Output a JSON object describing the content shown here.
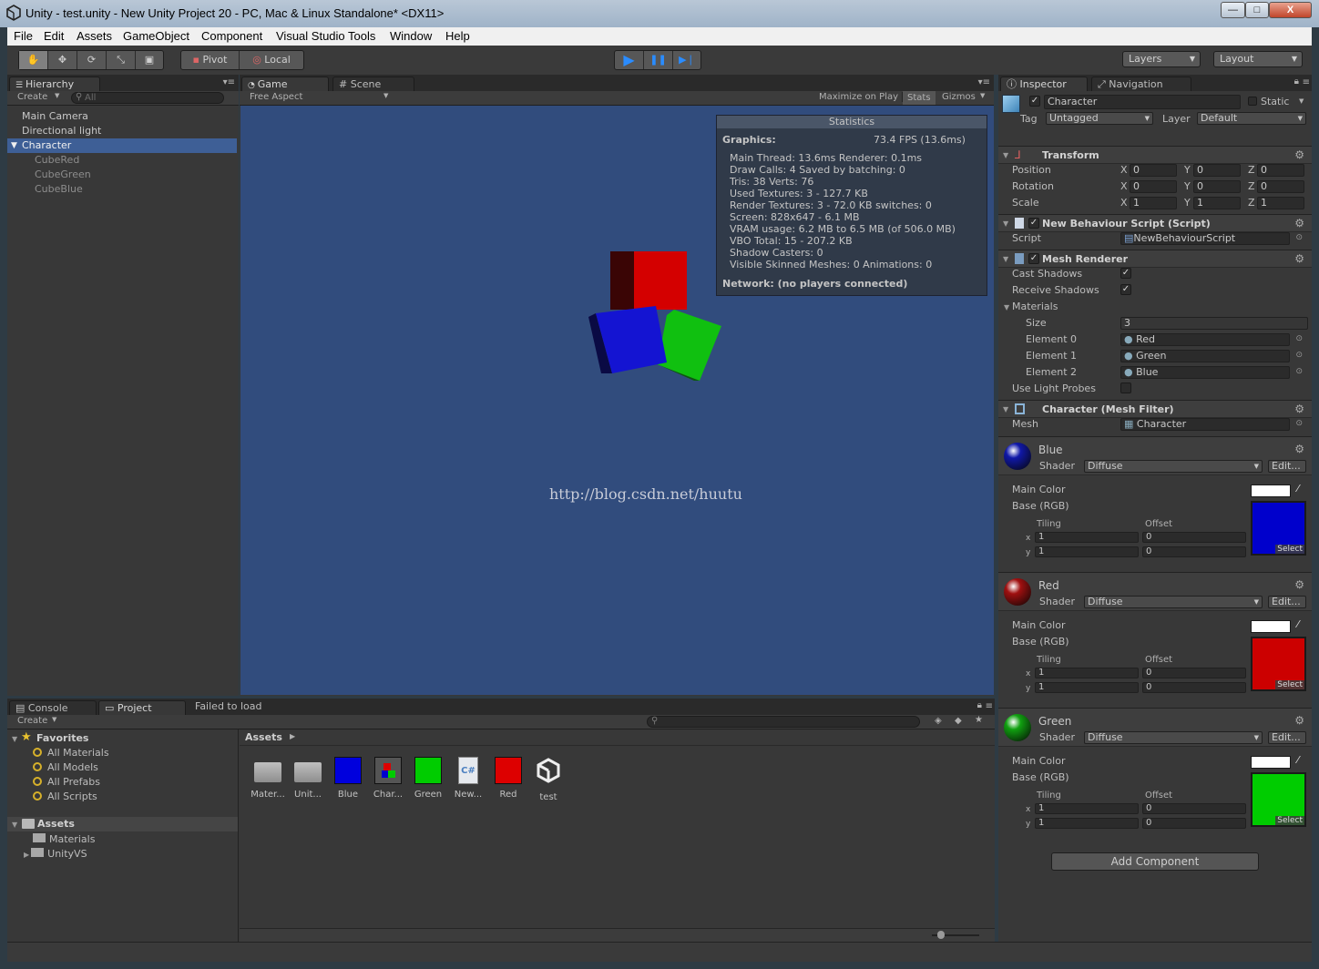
{
  "window": {
    "title": "Unity - test.unity - New Unity Project 20 - PC, Mac & Linux Standalone* <DX11>",
    "min_label": "—",
    "max_label": "□",
    "close_label": "X"
  },
  "menu": [
    "File",
    "Edit",
    "Assets",
    "GameObject",
    "Component",
    "Visual Studio Tools",
    "Window",
    "Help"
  ],
  "toolbar": {
    "pivot": "Pivot",
    "local": "Local",
    "layers": "Layers",
    "layout": "Layout"
  },
  "hierarchy": {
    "tab": "Hierarchy",
    "create": "Create",
    "search_placeholder": "All",
    "items": [
      "Main Camera",
      "Directional light",
      "Character",
      "CubeRed",
      "CubeGreen",
      "CubeBlue"
    ]
  },
  "game": {
    "tab_game": "Game",
    "tab_scene": "Scene",
    "aspect": "Free Aspect",
    "maximize": "Maximize on Play",
    "stats": "Stats",
    "gizmos": "Gizmos",
    "watermark": "http://blog.csdn.net/huutu"
  },
  "stats": {
    "title": "Statistics",
    "graphics_label": "Graphics:",
    "fps": "73.4 FPS (13.6ms)",
    "lines": [
      "Main Thread: 13.6ms  Renderer: 0.1ms",
      "Draw Calls: 4          Saved by batching: 0",
      "Tris: 38   Verts: 76",
      "Used Textures: 3 - 127.7 KB",
      "Render Textures: 3 - 72.0 KB    switches: 0",
      "Screen: 828x647 - 6.1 MB",
      "VRAM usage: 6.2 MB to 6.5 MB (of 506.0 MB)",
      "VBO Total: 15 - 207.2 KB",
      "Shadow Casters: 0",
      "Visible Skinned Meshes: 0         Animations: 0"
    ],
    "network": "Network: (no players connected)"
  },
  "inspector": {
    "tab_inspector": "Inspector",
    "tab_navigation": "Navigation",
    "object_name": "Character",
    "static": "Static",
    "tag_label": "Tag",
    "tag_value": "Untagged",
    "layer_label": "Layer",
    "layer_value": "Default",
    "transform": {
      "title": "Transform",
      "rows": [
        {
          "label": "Position",
          "x": "0",
          "y": "0",
          "z": "0"
        },
        {
          "label": "Rotation",
          "x": "0",
          "y": "0",
          "z": "0"
        },
        {
          "label": "Scale",
          "x": "1",
          "y": "1",
          "z": "1"
        }
      ],
      "x": "X",
      "y": "Y",
      "z": "Z"
    },
    "script": {
      "title": "New Behaviour Script (Script)",
      "label": "Script",
      "value": "NewBehaviourScript"
    },
    "mesh_renderer": {
      "title": "Mesh Renderer",
      "cast_shadows": "Cast Shadows",
      "receive_shadows": "Receive Shadows",
      "materials": "Materials",
      "size_label": "Size",
      "size_value": "3",
      "elements": [
        {
          "label": "Element 0",
          "value": "Red"
        },
        {
          "label": "Element 1",
          "value": "Green"
        },
        {
          "label": "Element 2",
          "value": "Blue"
        }
      ],
      "light_probes": "Use Light Probes"
    },
    "mesh_filter": {
      "title": "Character (Mesh Filter)",
      "label": "Mesh",
      "value": "Character"
    },
    "materials": [
      {
        "name": "Blue",
        "color": "#0000cc",
        "sphere": "#1018a8"
      },
      {
        "name": "Red",
        "color": "#cc0000",
        "sphere": "#a01010"
      },
      {
        "name": "Green",
        "color": "#00cc00",
        "sphere": "#10a010"
      }
    ],
    "mat_labels": {
      "shader": "Shader",
      "shader_value": "Diffuse",
      "edit": "Edit...",
      "main_color": "Main Color",
      "base": "Base (RGB)",
      "tiling": "Tiling",
      "offset": "Offset",
      "x": "x",
      "y": "y",
      "tile_value": "1",
      "offset_value": "0",
      "select": "Select"
    },
    "add_component": "Add Component"
  },
  "bottom": {
    "tab_console": "Console",
    "tab_project": "Project",
    "status": "Failed to load",
    "create": "Create",
    "favorites": "Favorites",
    "fav_items": [
      "All Materials",
      "All Models",
      "All Prefabs",
      "All Scripts"
    ],
    "assets_root": "Assets",
    "folders": [
      "Materials",
      "UnityVS"
    ],
    "breadcrumb": "Assets",
    "assets": [
      {
        "name": "Mater...",
        "kind": "folder"
      },
      {
        "name": "Unit...",
        "kind": "folder"
      },
      {
        "name": "Blue",
        "kind": "material",
        "color": "#0000dd"
      },
      {
        "name": "Char...",
        "kind": "prefab"
      },
      {
        "name": "Green",
        "kind": "material",
        "color": "#00cc00"
      },
      {
        "name": "New...",
        "kind": "script"
      },
      {
        "name": "Red",
        "kind": "material",
        "color": "#dd0000"
      },
      {
        "name": "test",
        "kind": "scene"
      }
    ]
  }
}
